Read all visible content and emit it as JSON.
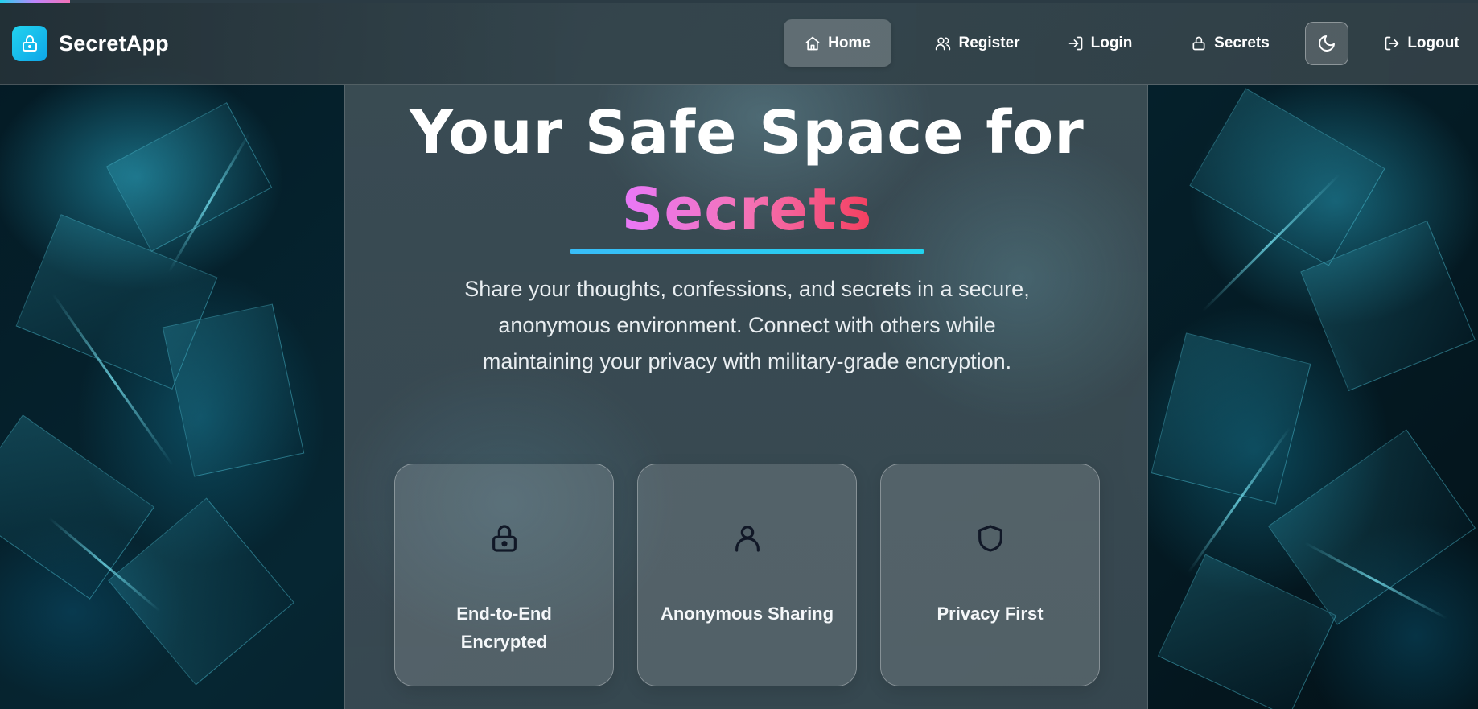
{
  "app": {
    "name": "SecretApp",
    "logo_icon": "lock-icon"
  },
  "nav": {
    "items": [
      {
        "label": "Home",
        "icon": "home-icon",
        "active": true
      },
      {
        "label": "Register",
        "icon": "users-icon",
        "active": false
      },
      {
        "label": "Login",
        "icon": "login-icon",
        "active": false
      },
      {
        "label": "Secrets",
        "icon": "lock-icon",
        "active": false
      },
      {
        "label": "Logout",
        "icon": "logout-icon",
        "active": false
      }
    ],
    "theme_toggle_icon": "moon-icon"
  },
  "hero": {
    "title_line1": "Your Safe Space for",
    "title_highlight": "Secrets",
    "description": "Share your thoughts, confessions, and secrets in a secure, anonymous environment. Connect with others while maintaining your privacy with military-grade encryption."
  },
  "features": [
    {
      "title": "End-to-End Encrypted",
      "icon": "lock-icon"
    },
    {
      "title": "Anonymous Sharing",
      "icon": "user-icon"
    },
    {
      "title": "Privacy First",
      "icon": "shield-icon"
    }
  ],
  "colors": {
    "accent_cyan": "#22d3ee",
    "highlight_pink": "#f472b6",
    "highlight_red": "#f43f5e",
    "icon_dark": "#111827"
  }
}
